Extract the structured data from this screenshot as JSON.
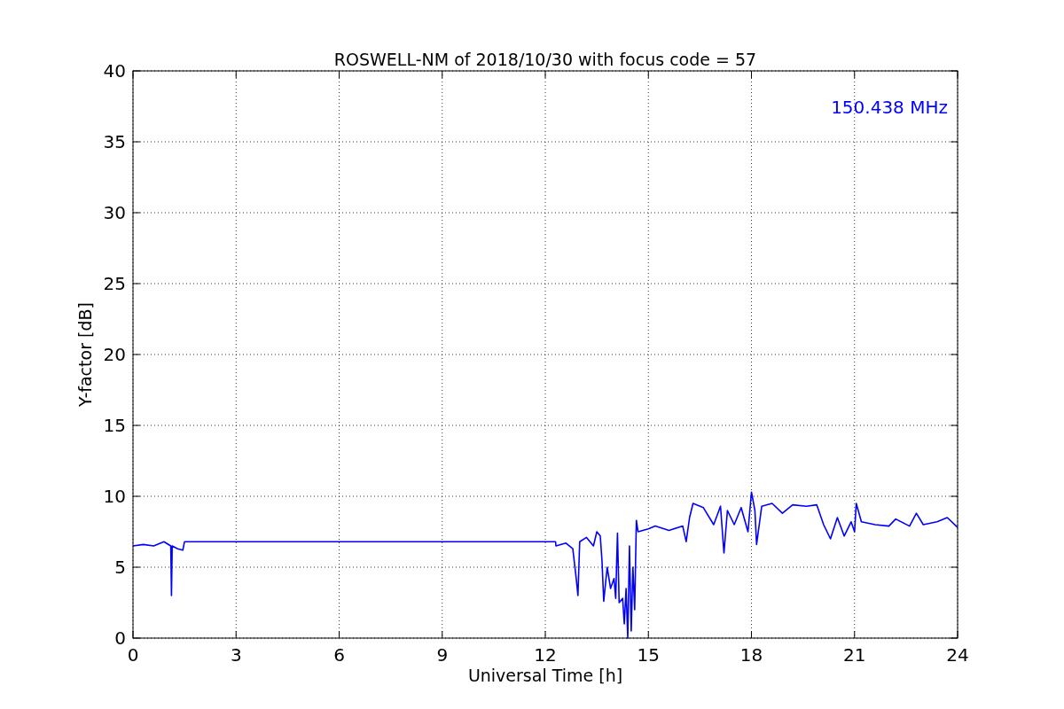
{
  "figure": {
    "chart_data": {
      "type": "line",
      "title": "ROSWELL-NM of 2018/10/30 with focus code = 57",
      "xlabel": "Universal Time [h]",
      "ylabel": "Y-factor [dB]",
      "xlim": [
        0,
        24
      ],
      "ylim": [
        0,
        40
      ],
      "xticks": [
        0,
        3,
        6,
        9,
        12,
        15,
        18,
        21,
        24
      ],
      "yticks": [
        0,
        5,
        10,
        15,
        20,
        25,
        30,
        35,
        40
      ],
      "x": [
        0,
        0.3,
        0.6,
        0.9,
        1.1,
        1.12,
        1.14,
        1.3,
        1.45,
        1.5,
        12.3,
        12.31,
        12.6,
        12.8,
        12.9,
        12.95,
        13.0,
        13.2,
        13.4,
        13.5,
        13.6,
        13.65,
        13.7,
        13.8,
        13.9,
        14.0,
        14.05,
        14.1,
        14.15,
        14.25,
        14.3,
        14.35,
        14.4,
        14.45,
        14.5,
        14.55,
        14.6,
        14.65,
        14.7,
        15.0,
        15.2,
        15.6,
        16.0,
        16.1,
        16.2,
        16.3,
        16.6,
        16.9,
        17.1,
        17.2,
        17.3,
        17.5,
        17.7,
        17.9,
        18.0,
        18.1,
        18.15,
        18.3,
        18.6,
        18.9,
        19.2,
        19.6,
        19.9,
        20.1,
        20.3,
        20.5,
        20.7,
        20.9,
        21.0,
        21.05,
        21.2,
        21.6,
        22.0,
        22.2,
        22.6,
        22.8,
        23.0,
        23.4,
        23.7,
        24.0
      ],
      "series": [
        {
          "name": "150.438 MHz",
          "color": "#0000ff",
          "values": [
            6.5,
            6.6,
            6.5,
            6.8,
            6.5,
            3.0,
            6.5,
            6.3,
            6.2,
            6.8,
            6.8,
            6.5,
            6.7,
            6.3,
            4.2,
            3.0,
            6.8,
            7.1,
            6.5,
            7.5,
            7.2,
            5.5,
            2.6,
            5.0,
            3.5,
            4.2,
            2.8,
            7.4,
            2.5,
            2.8,
            1.0,
            3.5,
            0.0,
            6.5,
            0.5,
            5.0,
            2.0,
            8.3,
            7.5,
            7.7,
            7.9,
            7.6,
            7.9,
            6.8,
            8.5,
            9.5,
            9.2,
            8.0,
            9.3,
            6.0,
            9.0,
            8.0,
            9.2,
            7.5,
            10.3,
            9.0,
            6.6,
            9.3,
            9.5,
            8.8,
            9.4,
            9.3,
            9.4,
            8.0,
            7.0,
            8.5,
            7.2,
            8.2,
            7.5,
            9.5,
            8.2,
            8.0,
            7.9,
            8.4,
            7.9,
            8.8,
            8.0,
            8.2,
            8.5,
            7.8
          ]
        }
      ],
      "grid": true
    }
  }
}
